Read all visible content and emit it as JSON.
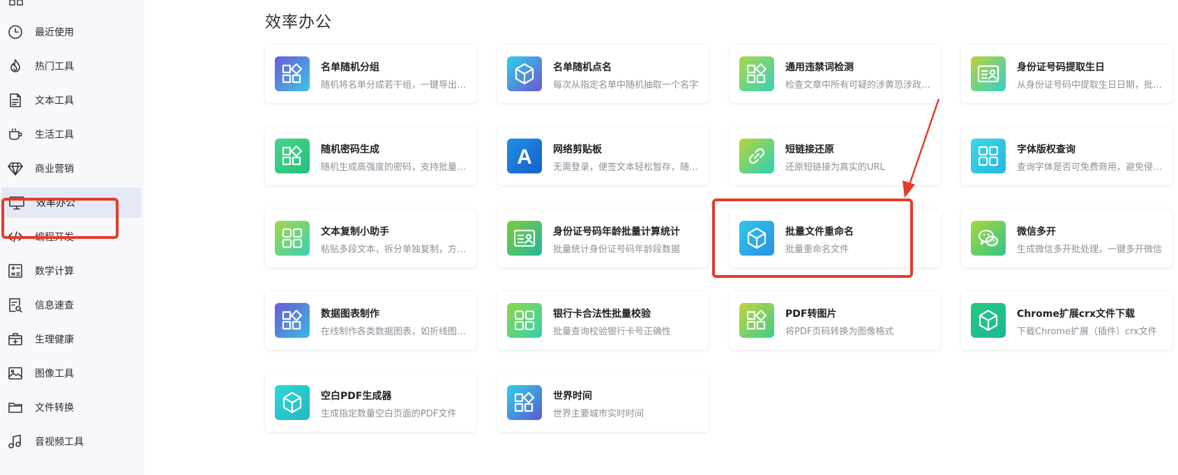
{
  "sidebar": {
    "items": [
      {
        "label": "最近使用",
        "icon": "clock-icon"
      },
      {
        "label": "热门工具",
        "icon": "flame-icon"
      },
      {
        "label": "文本工具",
        "icon": "document-icon"
      },
      {
        "label": "生活工具",
        "icon": "cup-icon"
      },
      {
        "label": "商业营销",
        "icon": "diamond-icon"
      },
      {
        "label": "效率办公",
        "icon": "monitor-icon",
        "active": true
      },
      {
        "label": "编程开发",
        "icon": "code-icon"
      },
      {
        "label": "数学计算",
        "icon": "calculator-icon"
      },
      {
        "label": "信息速查",
        "icon": "search-doc-icon"
      },
      {
        "label": "生理健康",
        "icon": "medical-kit-icon"
      },
      {
        "label": "图像工具",
        "icon": "image-icon"
      },
      {
        "label": "文件转换",
        "icon": "folder-icon"
      },
      {
        "label": "音视频工具",
        "icon": "music-icon"
      }
    ]
  },
  "main": {
    "section_title": "效率办公",
    "cards": [
      {
        "title": "名单随机分组",
        "desc": "随机将名单分成若干组，一键导出分组结果",
        "icon": "grid-diamond-icon",
        "colors": [
          "#6b5bd6",
          "#3cc3e8"
        ]
      },
      {
        "title": "名单随机点名",
        "desc": "每次从指定名单中随机抽取一个名字",
        "icon": "cube-icon",
        "colors": [
          "#2fd0e6",
          "#6a58d2"
        ]
      },
      {
        "title": "通用违禁词检测",
        "desc": "检查文章中所有可疑的涉黄恐涉政违禁词",
        "icon": "grid-diamond-icon",
        "colors": [
          "#a8d84a",
          "#35d2b4"
        ]
      },
      {
        "title": "身份证号码提取生日",
        "desc": "从身份证号码中提取生日日期，批量处理",
        "icon": "id-card-icon",
        "colors": [
          "#b7d23a",
          "#35d0c6"
        ]
      },
      {
        "title": "随机密码生成",
        "desc": "随机生成高强度的密码，支持批量生成",
        "icon": "grid-diamond-icon",
        "colors": [
          "#4ad48a",
          "#23c07a"
        ]
      },
      {
        "title": "网络剪贴板",
        "desc": "无需登录，便签文本轻松暂存，随时取用",
        "icon": "letter-a-icon",
        "colors": [
          "#1e90e6",
          "#1760c8"
        ]
      },
      {
        "title": "短链接还原",
        "desc": "还原短链接为真实的URL",
        "icon": "link-icon",
        "colors": [
          "#b6d43a",
          "#2ed0b8"
        ]
      },
      {
        "title": "字体版权查询",
        "desc": "查询字体是否可免费商用，避免侵权风险",
        "icon": "grid-four-icon",
        "colors": [
          "#3ed6e6",
          "#22b8e0"
        ]
      },
      {
        "title": "文本复制小助手",
        "desc": "粘贴多段文本，拆分单独复制，方便快捷",
        "icon": "grid-four-icon",
        "colors": [
          "#a4d84a",
          "#38d0b0"
        ]
      },
      {
        "title": "身份证号码年龄批量计算统计",
        "desc": "批量统计身份证号码年龄段数据",
        "icon": "id-card-icon",
        "colors": [
          "#7ccc3a",
          "#23b89a"
        ]
      },
      {
        "title": "批量文件重命名",
        "desc": "批量重命名文件",
        "icon": "cube-icon",
        "colors": [
          "#2fc8ec",
          "#2a8fe4"
        ]
      },
      {
        "title": "微信多开",
        "desc": "生成微信多开批处理，一键多开微信",
        "icon": "wechat-icon",
        "colors": [
          "#a8d83c",
          "#30c48a"
        ]
      },
      {
        "title": "数据图表制作",
        "desc": "在线制作各类数据图表，如折线图柱状图",
        "icon": "grid-diamond-icon",
        "colors": [
          "#6a5ad4",
          "#3ab8e6"
        ]
      },
      {
        "title": "银行卡合法性批量校验",
        "desc": "批量查询校验银行卡号正确性",
        "icon": "grid-four-icon",
        "colors": [
          "#8ed84a",
          "#35cfa8"
        ]
      },
      {
        "title": "PDF转图片",
        "desc": "将PDF页码转换为图像格式",
        "icon": "grid-diamond-icon",
        "colors": [
          "#c4d43a",
          "#3ccf8a"
        ]
      },
      {
        "title": "Chrome扩展crx文件下载",
        "desc": "下载Chrome扩展（插件）crx文件",
        "icon": "cube-icon",
        "colors": [
          "#23c87e",
          "#1cb89a"
        ]
      },
      {
        "title": "空白PDF生成器",
        "desc": "生成指定数量空白页面的PDF文件",
        "icon": "cube-icon",
        "colors": [
          "#2fd6d6",
          "#22b8c6"
        ]
      },
      {
        "title": "世界时间",
        "desc": "世界主要城市实时时间",
        "icon": "grid-diamond-icon",
        "colors": [
          "#2ed0e6",
          "#5a5ad6"
        ]
      }
    ]
  },
  "annotation": {
    "color": "#e63a2a"
  }
}
